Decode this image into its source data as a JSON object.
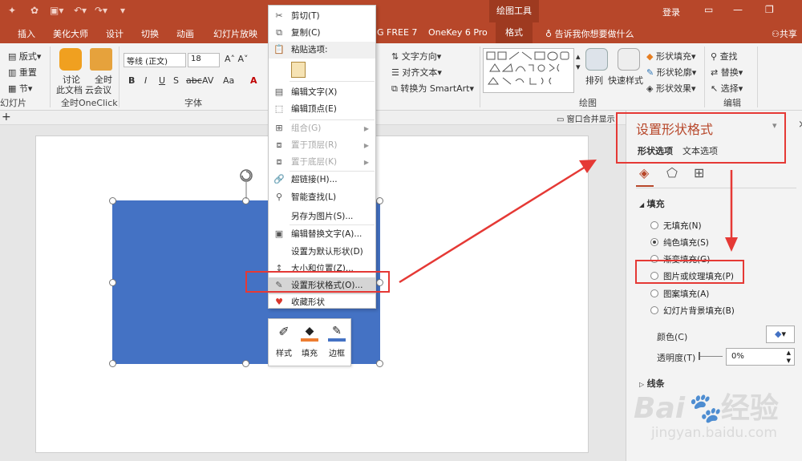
{
  "titlebar": {
    "contextual_tool": "绘图工具",
    "login": "登录"
  },
  "tabs": [
    "插入",
    "美化大师",
    "设计",
    "切换",
    "动画",
    "幻灯片放映",
    "G FREE 7",
    "OneKey 6 Pro",
    "格式"
  ],
  "active_tab": "格式",
  "tell_me": "告诉我你想要做什么",
  "share": "共享",
  "ribbon": {
    "slides": {
      "layout": "版式",
      "reset": "重置",
      "section": "节",
      "group": "幻灯片"
    },
    "oneclick": {
      "discuss": "讨论",
      "doc": "此文档",
      "all_time": "全时",
      "cloud_meeting": "云会议",
      "group": "全时OneClick"
    },
    "font": {
      "name": "等线 (正文)",
      "size": "18",
      "bold": "B",
      "italic": "I",
      "underline": "U",
      "shadow": "S",
      "strike": "abc",
      "spacing": "AV",
      "case": "Aa",
      "group": "字体"
    },
    "paragraph": {
      "text_direction": "文字方向",
      "align_text": "对齐文本",
      "smartart": "转换为 SmartArt"
    },
    "drawing": {
      "arrange": "排列",
      "quick_styles": "快速样式",
      "shape_fill": "形状填充",
      "shape_outline": "形状轮廓",
      "shape_effects": "形状效果",
      "group": "绘图"
    },
    "editing": {
      "find": "查找",
      "replace": "替换",
      "select": "选择",
      "group": "编辑"
    }
  },
  "strip": {
    "window_merge": "窗口合并显示"
  },
  "context_menu": {
    "items": [
      {
        "label": "剪切(T)",
        "icon": "scissors-icon",
        "disabled": false
      },
      {
        "label": "复制(C)",
        "icon": "copy-icon",
        "disabled": false
      },
      {
        "label": "粘贴选项:",
        "icon": "paste-icon",
        "disabled": false
      },
      {
        "label": "编辑文字(X)",
        "icon": "edit-text-icon",
        "disabled": false
      },
      {
        "label": "编辑顶点(E)",
        "icon": "edit-points-icon",
        "disabled": false
      },
      {
        "label": "组合(G)",
        "icon": "group-icon",
        "disabled": true
      },
      {
        "label": "置于顶层(R)",
        "icon": "bring-front-icon",
        "disabled": true
      },
      {
        "label": "置于底层(K)",
        "icon": "send-back-icon",
        "disabled": true
      },
      {
        "label": "超链接(H)...",
        "icon": "hyperlink-icon",
        "disabled": false
      },
      {
        "label": "智能查找(L)",
        "icon": "smart-lookup-icon",
        "disabled": false
      },
      {
        "label": "另存为图片(S)...",
        "icon": "",
        "disabled": false
      },
      {
        "label": "编辑替换文字(A)...",
        "icon": "alt-text-icon",
        "disabled": false
      },
      {
        "label": "设置为默认形状(D)",
        "icon": "",
        "disabled": false
      },
      {
        "label": "大小和位置(Z)...",
        "icon": "size-position-icon",
        "disabled": false
      },
      {
        "label": "设置形状格式(O)...",
        "icon": "format-shape-icon",
        "disabled": false
      },
      {
        "label": "收藏形状",
        "icon": "heart-icon",
        "disabled": false
      }
    ]
  },
  "mini_toolbar": {
    "style": "样式",
    "fill": "填充",
    "border": "边框"
  },
  "pane": {
    "title": "设置形状格式",
    "tab_shape": "形状选项",
    "tab_text": "文本选项",
    "fill_section": "填充",
    "fill_options": [
      "无填充(N)",
      "纯色填充(S)",
      "渐变填充(G)",
      "图片或纹理填充(P)",
      "图案填充(A)",
      "幻灯片背景填充(B)"
    ],
    "fill_selected": 1,
    "color_label": "颜色(C)",
    "transparency_label": "透明度(T)",
    "transparency_value": "0%",
    "line_section": "线条"
  },
  "watermark": {
    "brand": "Bai",
    "brand_cn": "经验",
    "url": "jingyan.baidu.com"
  },
  "colors": {
    "accent": "#b7472a",
    "shape_fill": "#4472c4",
    "annotation": "#e53935"
  }
}
